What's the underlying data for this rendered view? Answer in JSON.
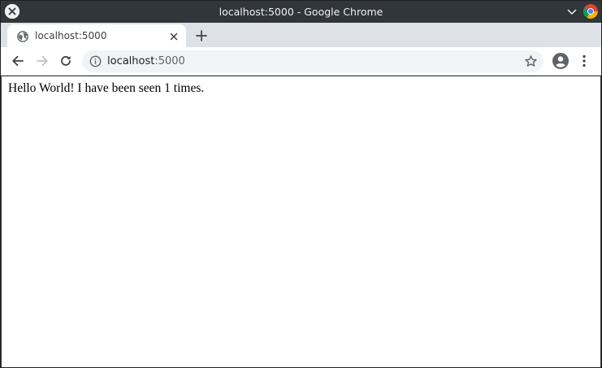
{
  "window": {
    "title": "localhost:5000 - Google Chrome"
  },
  "icons": {
    "close": "close-icon",
    "minimize": "chevron-down-icon",
    "app": "chrome-logo-icon",
    "favicon": "globe-icon",
    "tab_close": "close-icon",
    "new_tab": "plus-icon",
    "back": "arrow-left-icon",
    "forward": "arrow-right-icon",
    "reload": "reload-icon",
    "site_info": "info-icon",
    "bookmark": "star-icon",
    "profile": "account-icon",
    "menu": "kebab-menu-icon"
  },
  "tabs": [
    {
      "label": "localhost:5000",
      "active": true
    }
  ],
  "omnibox": {
    "host": "localhost",
    "port": ":5000"
  },
  "page": {
    "message": "Hello World! I have been seen 1 times."
  },
  "colors": {
    "titlebar": "#31363b",
    "tabstrip": "#dee1e6",
    "omnibox": "#f1f3f4",
    "chrome_red": "#db4437",
    "chrome_green": "#0f9d58",
    "chrome_yellow": "#f4b400",
    "chrome_blue": "#4285f4"
  }
}
